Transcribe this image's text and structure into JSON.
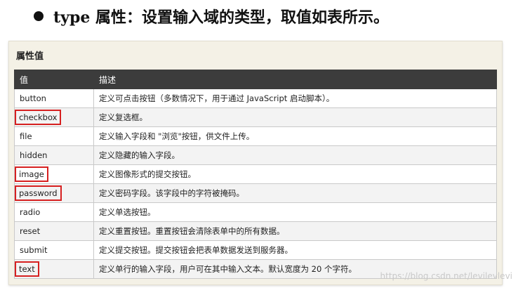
{
  "heading": {
    "text": "type 属性：设置输入域的类型，取值如表所示。"
  },
  "panel": {
    "title": "属性值"
  },
  "table": {
    "headers": [
      "值",
      "描述"
    ],
    "rows": [
      {
        "value": "button",
        "desc": "定义可点击按钮（多数情况下，用于通过 JavaScript 启动脚本）。",
        "highlighted": false
      },
      {
        "value": "checkbox",
        "desc": "定义复选框。",
        "highlighted": true
      },
      {
        "value": "file",
        "desc": "定义输入字段和 \"浏览\"按钮，供文件上传。",
        "highlighted": false
      },
      {
        "value": "hidden",
        "desc": "定义隐藏的输入字段。",
        "highlighted": false
      },
      {
        "value": "image",
        "desc": "定义图像形式的提交按钮。",
        "highlighted": true
      },
      {
        "value": "password",
        "desc": "定义密码字段。该字段中的字符被掩码。",
        "highlighted": true
      },
      {
        "value": "radio",
        "desc": "定义单选按钮。",
        "highlighted": false
      },
      {
        "value": "reset",
        "desc": "定义重置按钮。重置按钮会清除表单中的所有数据。",
        "highlighted": false
      },
      {
        "value": "submit",
        "desc": "定义提交按钮。提交按钮会把表单数据发送到服务器。",
        "highlighted": false
      },
      {
        "value": "text",
        "desc": "定义单行的输入字段，用户可在其中输入文本。默认宽度为 20 个字符。",
        "highlighted": true
      }
    ]
  },
  "watermark": "https://blog.csdn.net/levilevlevi",
  "colors": {
    "highlight_border": "#d62020",
    "header_bg": "#3c3c3c",
    "panel_bg": "#f4f1e6"
  }
}
